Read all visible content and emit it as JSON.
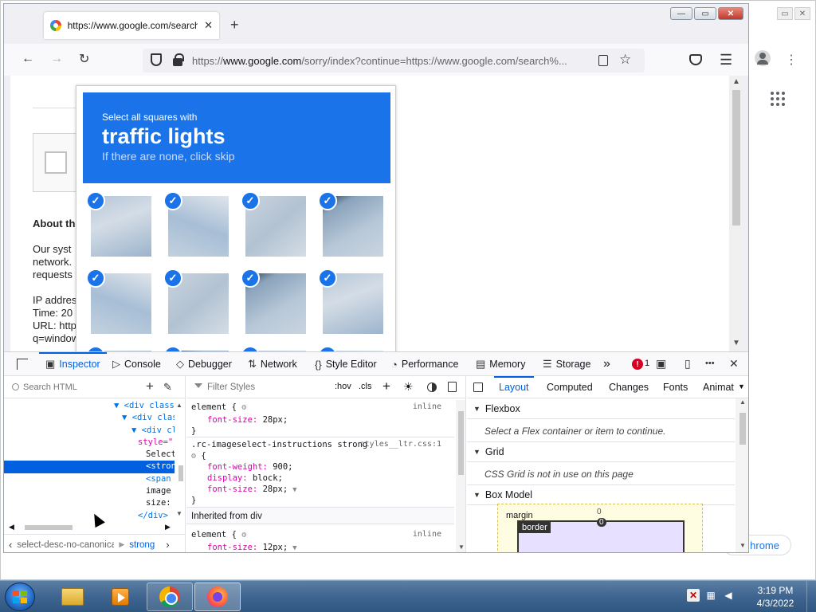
{
  "background_window": {
    "chrome_button_label": "hrome"
  },
  "browser": {
    "tab_title": "https://www.google.com/search?q=window",
    "tab_close": "✕",
    "new_tab": "+",
    "url_domain": "www.google.com",
    "url_prefix": "https://",
    "url_path": "/sorry/index?continue=https://www.google.com/search%..."
  },
  "page": {
    "about_heading": "About th",
    "about_lines": [
      "Our syst",
      "network.",
      "requests"
    ],
    "info_lines": [
      "IP addres",
      "Time: 20",
      "URL: http",
      "q=window"
    ]
  },
  "captcha": {
    "instruction_line": "Select all squares with",
    "target": "traffic lights",
    "skip_hint": "If there are none, click skip",
    "tiles_selected": [
      true,
      true,
      true,
      true,
      true,
      true,
      true,
      true,
      true,
      true,
      true,
      true
    ],
    "check_glyph": "✓"
  },
  "devtools": {
    "tabs": [
      "Inspector",
      "Console",
      "Debugger",
      "Network",
      "Style Editor",
      "Performance",
      "Memory",
      "Storage"
    ],
    "overflow": "»",
    "error_count": "1",
    "close_glyph": "✕",
    "more_glyph": "•••",
    "search_html_placeholder": "Search HTML",
    "markup_lines": [
      {
        "text": "▼ <div class=",
        "cls": "tag"
      },
      {
        "text": "▼ <div clas",
        "cls": "tag"
      },
      {
        "text": "▼ <div cla",
        "cls": "tag"
      },
      {
        "text": "style=\"",
        "cls": "attr"
      },
      {
        "text": "Select",
        "cls": "text"
      },
      {
        "text": "<stron",
        "cls": "sel"
      },
      {
        "text": "<span",
        "cls": "tag"
      },
      {
        "text": "image",
        "cls": "text"
      },
      {
        "text": "size:",
        "cls": "text"
      },
      {
        "text": "</div>",
        "cls": "tag"
      }
    ],
    "breadcrumb_item1": "select-desc-no-canonical",
    "breadcrumb_item2": "strong",
    "filter_styles_placeholder": "Filter Styles",
    "hov_label": ":hov",
    "cls_label": ".cls",
    "rules": {
      "element1_selector": "element {",
      "element1_source": "inline",
      "element1_prop": "font-size",
      "element1_value": "28px;",
      "close_brace": "}",
      "rule2_selector": ".rc-imageselect-instructions strong",
      "rule2_source": "styles__ltr.css:1",
      "rule2_open": "{",
      "rule2_prop1": "font-weight",
      "rule2_value1": "900;",
      "rule2_prop2": "display",
      "rule2_value2": "block;",
      "rule2_prop3": "font-size",
      "rule2_value3": "28px;",
      "inherited_label": "Inherited from div",
      "element2_selector": "element {",
      "element2_source": "inline",
      "element2_prop": "font-size",
      "element2_value": "12px;"
    },
    "layout_tabs": [
      "Layout",
      "Computed",
      "Changes",
      "Fonts",
      "Animat"
    ],
    "flexbox_label": "Flexbox",
    "flexbox_msg": "Select a Flex container or item to continue.",
    "grid_label": "Grid",
    "grid_msg": "CSS Grid is not in use on this page",
    "boxmodel_label": "Box Model",
    "margin_label": "margin",
    "margin_top": "0",
    "border_label": "border",
    "border_top": "0"
  },
  "taskbar": {
    "time": "3:19 PM",
    "date": "4/3/2022"
  }
}
